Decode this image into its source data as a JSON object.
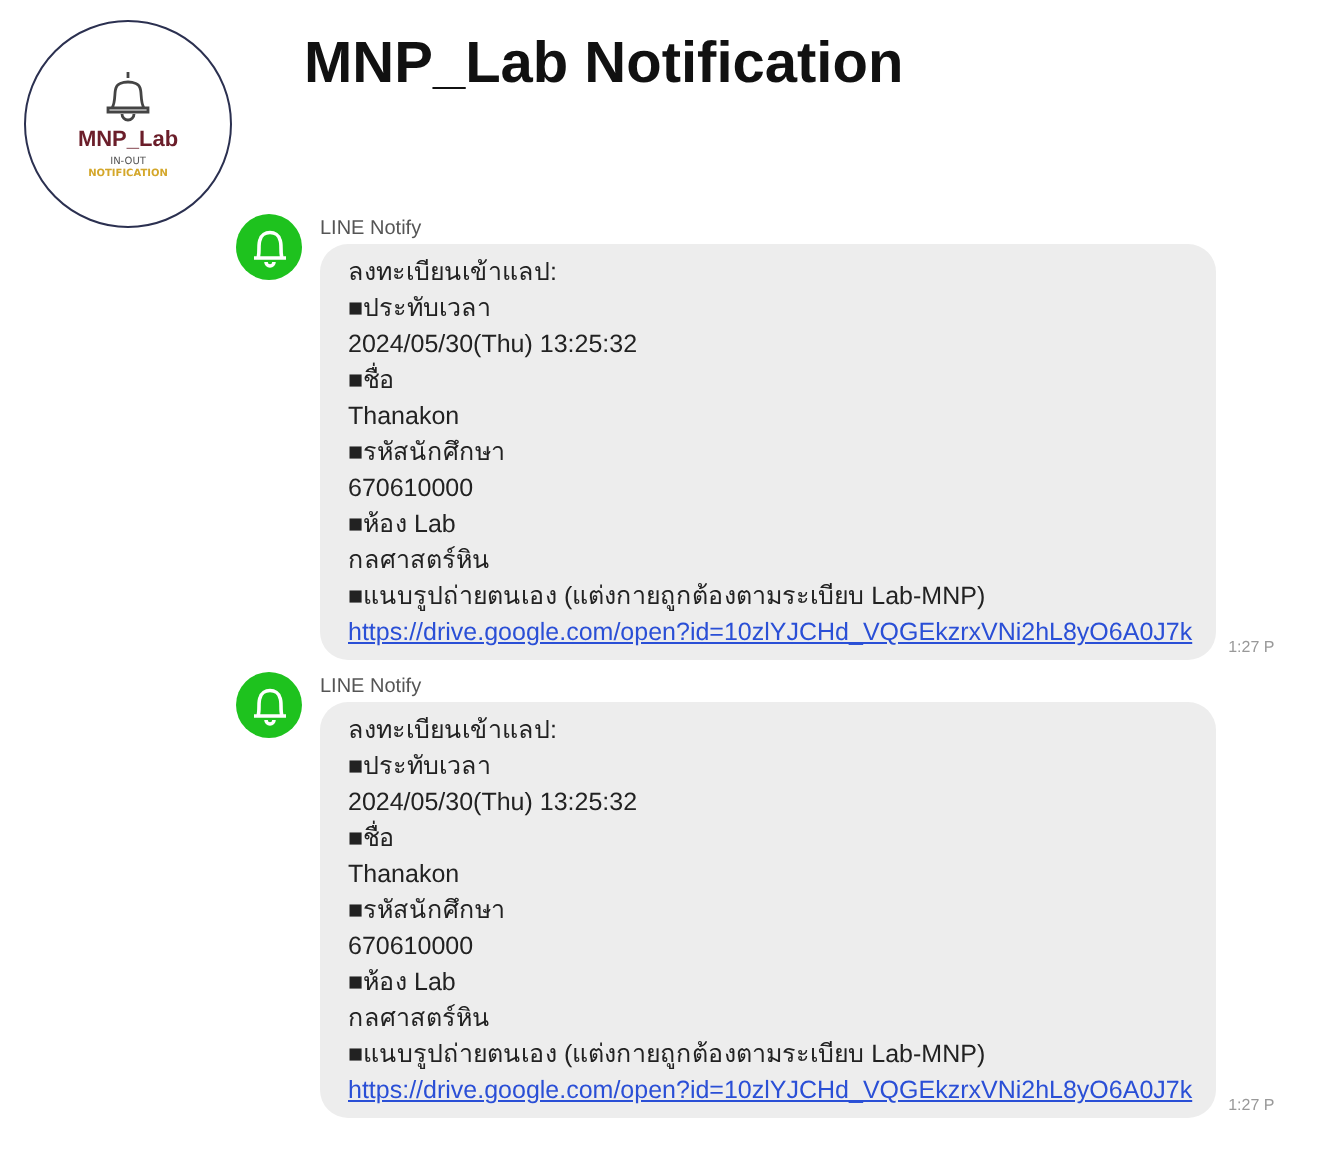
{
  "logo": {
    "name": "MNP_Lab",
    "sub": "IN-OUT",
    "tag": "NOTIFICATION"
  },
  "title": "MNP_Lab Notification",
  "messages": [
    {
      "sender": "LINE Notify",
      "lines": [
        "ลงทะเบียนเข้าแลป:",
        "■ประทับเวลา",
        "2024/05/30(Thu) 13:25:32",
        "■ชื่อ",
        "Thanakon",
        "■รหัสนักศึกษา",
        "670610000",
        "■ห้อง Lab",
        "กลศาสตร์หิน",
        "■แนบรูปถ่ายตนเอง (แต่งกายถูกต้องตามระเบียบ Lab-MNP)"
      ],
      "link": "https://drive.google.com/open?id=10zlYJCHd_VQGEkzrxVNi2hL8yO6A0J7k",
      "time": "1:27 P"
    },
    {
      "sender": "LINE Notify",
      "lines": [
        "ลงทะเบียนเข้าแลป:",
        "■ประทับเวลา",
        "2024/05/30(Thu) 13:25:32",
        "■ชื่อ",
        "Thanakon",
        "■รหัสนักศึกษา",
        "670610000",
        "■ห้อง Lab",
        "กลศาสตร์หิน",
        "■แนบรูปถ่ายตนเอง (แต่งกายถูกต้องตามระเบียบ Lab-MNP)"
      ],
      "link": "https://drive.google.com/open?id=10zlYJCHd_VQGEkzrxVNi2hL8yO6A0J7k",
      "time": "1:27 P"
    }
  ]
}
